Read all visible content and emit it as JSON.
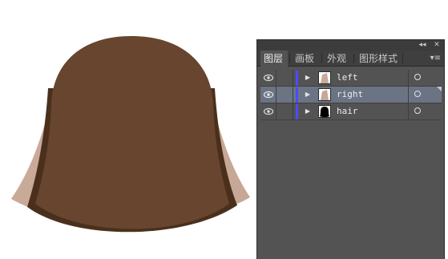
{
  "canvas": {
    "colors": {
      "hair_main": "#67452e",
      "hair_shadow": "#4a301c",
      "skin_left": "#c9aa98",
      "skin_right": "#c7a795"
    }
  },
  "layers_panel": {
    "titlebar": {
      "collapse_icon": "◂◂",
      "close_icon": "✕"
    },
    "tabs": [
      {
        "label": "图层",
        "active": true
      },
      {
        "label": "画板",
        "active": false
      },
      {
        "label": "外观",
        "active": false
      },
      {
        "label": "图形样式",
        "active": false
      }
    ],
    "menu_icon": "▾≡",
    "layer_color": "#4b4bff",
    "layers": [
      {
        "name": "left",
        "visible": true,
        "expanded": false,
        "selected": false,
        "thumbnail": "skin-thumbnail"
      },
      {
        "name": "right",
        "visible": true,
        "expanded": false,
        "selected": true,
        "thumbnail": "skin-thumbnail"
      },
      {
        "name": "hair",
        "visible": true,
        "expanded": false,
        "selected": false,
        "thumbnail": "hair-thumbnail"
      }
    ],
    "expand_icon": "▶"
  }
}
